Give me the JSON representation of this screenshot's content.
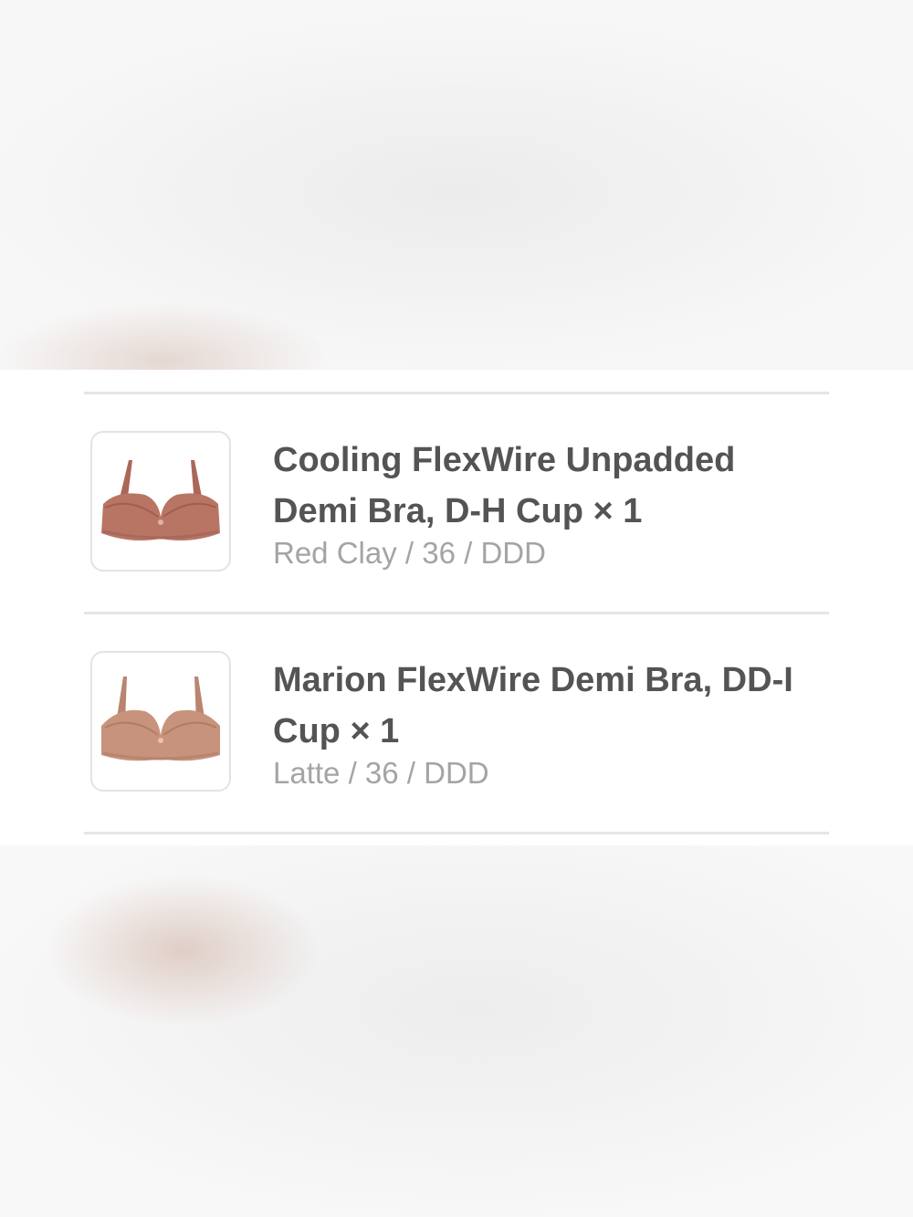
{
  "order": {
    "items": [
      {
        "name": "Cooling FlexWire Unpadded Demi Bra, D-H Cup",
        "quantity": "× 1",
        "variant": "Red Clay / 36 / DDD",
        "image_icon": "bra-product-image",
        "color": "#b87563"
      },
      {
        "name": "Marion FlexWire Demi Bra, DD-I Cup",
        "quantity": "× 1",
        "variant": "Latte / 36 / DDD",
        "image_icon": "bra-product-image",
        "color": "#c8937c"
      }
    ]
  }
}
